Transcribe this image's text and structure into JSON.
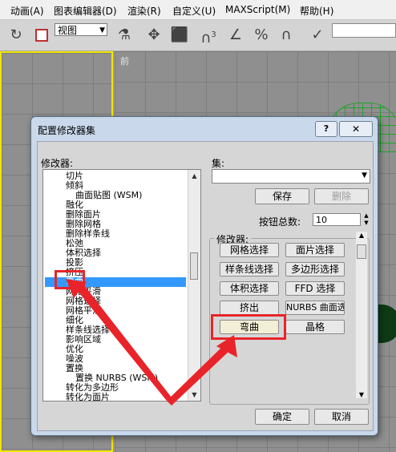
{
  "menubar": {
    "items": [
      "动画(A)",
      "图表编辑器(D)",
      "渲染(R)",
      "自定义(U)",
      "MAXScript(M)",
      "帮助(H)"
    ]
  },
  "toolbar": {
    "view_select": "视图",
    "icons": [
      "undo-icon",
      "square-icon",
      "select-icon",
      "move-icon",
      "box-icon",
      "snap-3-icon",
      "angle-snap-icon",
      "percent-snap-icon",
      "spinner-snap-icon",
      "spell-check-icon"
    ],
    "snap_label": "3"
  },
  "viewport": {
    "label": "前"
  },
  "dialog": {
    "title": "配置修改器集",
    "help_label": "?",
    "close_label": "✕",
    "modifiers_label": "修改器:",
    "modifiers": [
      "切片",
      "倾斜",
      "曲面贴图 (WSM)",
      "融化",
      "删除面片",
      "删除网格",
      "删除样条线",
      "松弛",
      "体积选择",
      "投影",
      "挤压",
      "弯曲",
      "网格平滑",
      "网格选择",
      "网格平滑",
      "细化",
      "样条线选择",
      "影响区域",
      "优化",
      "噪波",
      "置换",
      "置换 NURBS (WSM)",
      "转化为多边形",
      "转化为面片"
    ],
    "selected_index": 11,
    "set_label": "集:",
    "set_value": "",
    "save_label": "保存",
    "delete_label": "删除",
    "button_count_label": "按钮总数:",
    "button_count_value": "10",
    "group_label": "修改器:",
    "mod_buttons": [
      "网格选择",
      "面片选择",
      "样条线选择",
      "多边形选择",
      "体积选择",
      "FFD 选择",
      "挤出",
      "NURBS 曲面选择",
      "弯曲",
      "晶格"
    ],
    "ok_label": "确定",
    "cancel_label": "取消"
  },
  "accent_colors": {
    "selection": "#3399ff",
    "annotation": "#e8242a",
    "viewport_border": "#f3e600"
  }
}
